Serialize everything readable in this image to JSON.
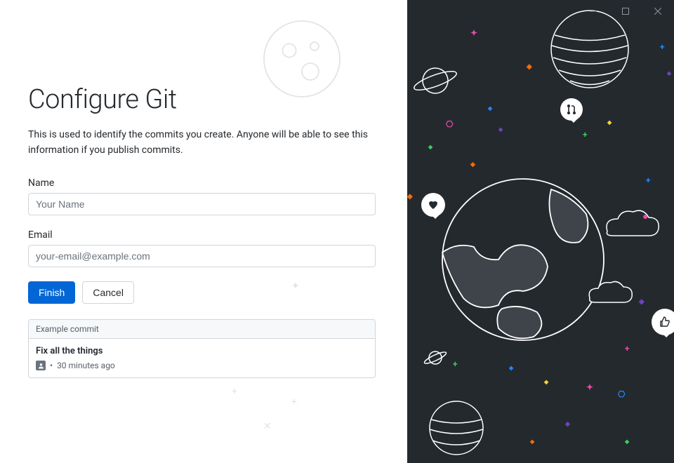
{
  "header": {
    "title": "Configure Git",
    "description": "This is used to identify the commits you create. Anyone will be able to see this information if you publish commits."
  },
  "form": {
    "name_label": "Name",
    "name_placeholder": "Your Name",
    "name_value": "",
    "email_label": "Email",
    "email_placeholder": "your-email@example.com",
    "email_value": ""
  },
  "buttons": {
    "finish": "Finish",
    "cancel": "Cancel"
  },
  "example": {
    "header": "Example commit",
    "commit_title": "Fix all the things",
    "separator": "•",
    "time": "30 minutes ago"
  },
  "icons": {
    "pr": "pull-request-icon",
    "heart": "heart-icon",
    "thumb": "thumbs-up-icon"
  },
  "colors": {
    "primary": "#0366d6",
    "dark_bg": "#24292e"
  }
}
